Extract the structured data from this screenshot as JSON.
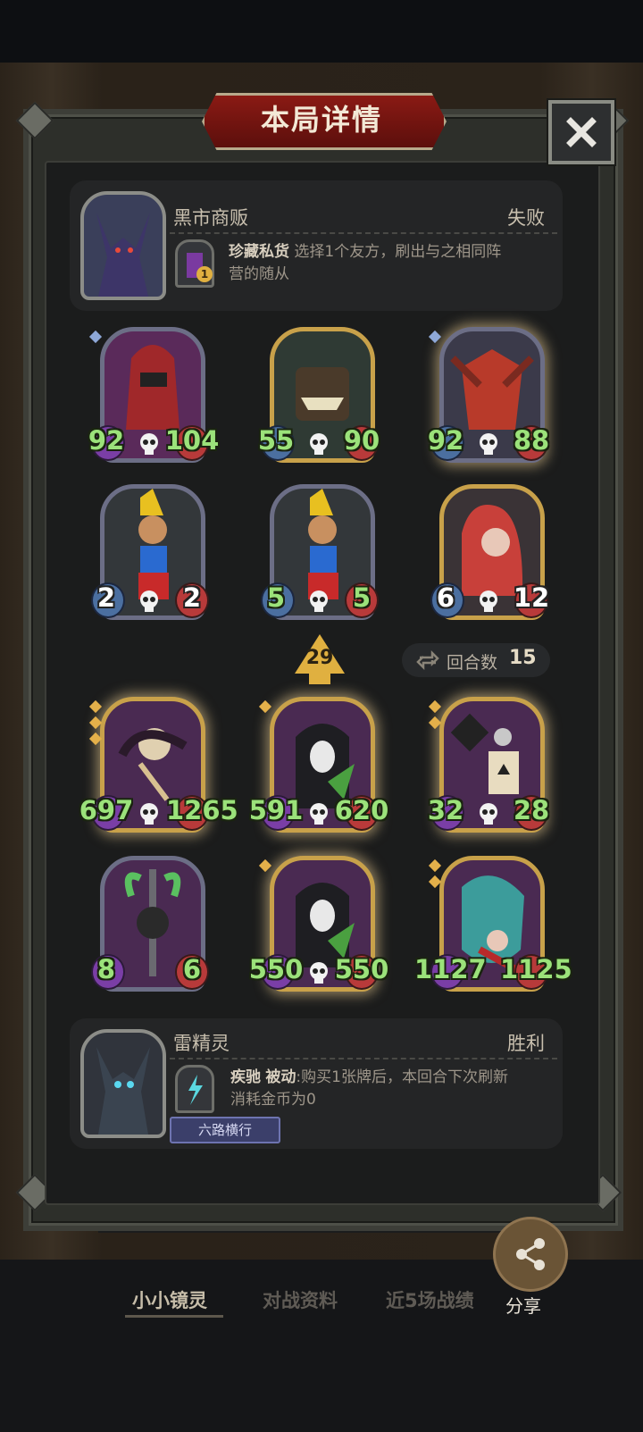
{
  "title": "本局详情",
  "opponent": {
    "name": "黑市商贩",
    "result": "失败",
    "ability_name": "珍藏私货",
    "ability_desc_line1": "选择1个友方，刷出与之相同阵",
    "ability_desc_line2": "营的随从",
    "ability_badge": "1"
  },
  "opponent_board": [
    {
      "atk": "92",
      "hp": "104"
    },
    {
      "atk": "55",
      "hp": "90"
    },
    {
      "atk": "92",
      "hp": "88"
    },
    {
      "atk": "2",
      "hp": "2"
    },
    {
      "atk": "5",
      "hp": "5"
    },
    {
      "atk": "6",
      "hp": "12"
    }
  ],
  "level": "29",
  "rounds": {
    "label": "回合数",
    "value": "15"
  },
  "my_board": [
    {
      "atk": "697",
      "hp": "1265"
    },
    {
      "atk": "591",
      "hp": "620"
    },
    {
      "atk": "32",
      "hp": "28"
    },
    {
      "atk": "8",
      "hp": "6"
    },
    {
      "atk": "550",
      "hp": "550"
    },
    {
      "atk": "1127",
      "hp": "1125"
    }
  ],
  "player": {
    "name": "雷精灵",
    "result": "胜利",
    "ability_name": "疾驰",
    "ability_type": "被动",
    "ability_desc_line1": ":购买1张牌后，本回合下次刷新",
    "ability_desc_line2": "消耗金币为0",
    "tag": "六路横行"
  },
  "bottom_nav": {
    "tab1": "小小镜灵",
    "tab2": "对战资料",
    "tab3": "近5场战绩",
    "share": "分享"
  },
  "icons": [
    "close-icon",
    "skull-icon",
    "swap-icon",
    "share-icon",
    "level-arrow-icon"
  ]
}
